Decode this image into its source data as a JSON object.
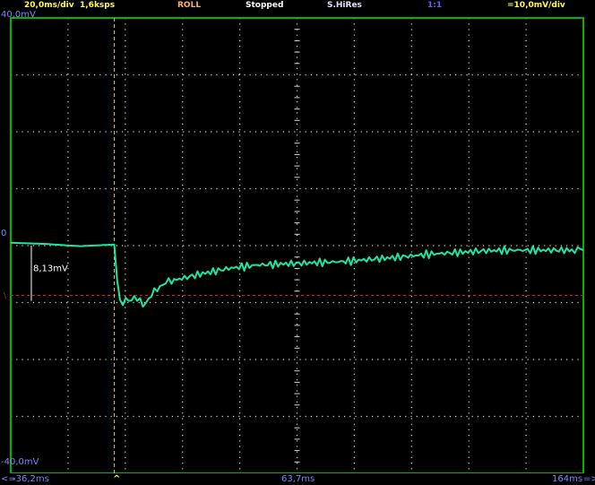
{
  "header": {
    "timebase": "20,0ms/div",
    "sample_rate": "1,6ksps",
    "mode": "ROLL",
    "state": "Stopped",
    "acquisition": "S.HiRes",
    "probe": "1:1",
    "channel_scale": "=10,0mV/div"
  },
  "axis": {
    "top_label": "40,0mV",
    "zero_label": "0",
    "bottom_label": "-40,0mV",
    "time_start": "-36,2ms",
    "time_mid": "63,7ms",
    "time_end": "164ms",
    "trigger_marker": "^",
    "left_arrow": "<=",
    "right_arrow": "=>"
  },
  "measurement": {
    "delta_label": "8,13mV"
  },
  "colors": {
    "trace": "#1ee6a0",
    "grid": "#d8d8d8",
    "frame": "#00b400",
    "cursor": "#d5d500",
    "reference": "#d02020",
    "timebase_text": "#ffff40",
    "mode_text": "#ffb060",
    "info_text": "#ffffff",
    "axis_text": "#7e83ff"
  },
  "chart_data": {
    "type": "line",
    "xlabel": "",
    "ylabel": "",
    "xlim": [
      -36.2,
      164
    ],
    "ylim": [
      -40,
      40
    ],
    "x_unit": "ms",
    "y_unit": "mV",
    "series": [
      {
        "x": [
          -36.2,
          -24,
          -12,
          0,
          1,
          2,
          3,
          4,
          7,
          10,
          13,
          16,
          20,
          30,
          40,
          50,
          60,
          70,
          80,
          90,
          100,
          110,
          120,
          130,
          140,
          150,
          160,
          164
        ],
        "y": [
          0.5,
          0.3,
          -0.1,
          0.2,
          -6.0,
          -9.5,
          -10.2,
          -9.8,
          -9.0,
          -10.4,
          -8.8,
          -7.0,
          -6.2,
          -5.0,
          -4.0,
          -3.4,
          -3.2,
          -3.0,
          -2.8,
          -2.4,
          -2.0,
          -1.5,
          -1.2,
          -0.9,
          -0.8,
          -0.8,
          -0.8,
          -0.8
        ]
      }
    ],
    "grid": true
  }
}
